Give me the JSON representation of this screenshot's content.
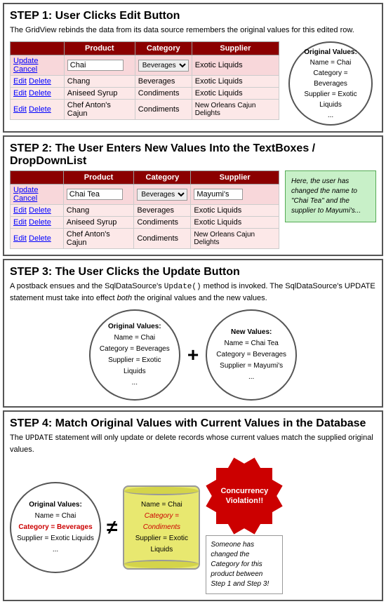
{
  "step1": {
    "title": "STEP 1: User Clicks Edit Button",
    "description": "The GridView rebinds the data from its data source remembers the original values for this edited row.",
    "original_values_circle": {
      "line1": "Original Values:",
      "line2": "Name = Chai",
      "line3": "Category = Beverages",
      "line4": "Supplier = Exotic Liquids",
      "line5": "..."
    },
    "table": {
      "headers": [
        "Product",
        "Category",
        "Supplier"
      ],
      "rows": [
        {
          "type": "edit",
          "actions": "Update Cancel",
          "product_input": "Chai",
          "category_select": "Beverages",
          "supplier": "Exotic Liquids"
        },
        {
          "type": "normal",
          "actions": "Edit Delete",
          "product": "Chang",
          "category": "Beverages",
          "supplier": "Exotic Liquids"
        },
        {
          "type": "normal",
          "actions": "Edit Delete",
          "product": "Aniseed Syrup",
          "category": "Condiments",
          "supplier": "Exotic Liquids"
        },
        {
          "type": "normal",
          "actions": "Edit Delete",
          "product": "Chef Anton's Cajun",
          "category": "Condiments",
          "supplier": "New Orleans Cajun Delights"
        }
      ]
    }
  },
  "step2": {
    "title": "STEP 2: The User Enters New Values Into the TextBoxes / DropDownList",
    "green_note": "Here, the user has changed the name to \"Chai Tea\" and the supplier to Mayumi's...",
    "table": {
      "headers": [
        "Product",
        "Category",
        "Supplier"
      ],
      "rows": [
        {
          "type": "edit",
          "actions": "Update Cancel",
          "product_input": "Chai Tea",
          "category_select": "Beverages",
          "supplier_input": "Mayumi's"
        },
        {
          "type": "normal",
          "actions": "Edit Delete",
          "product": "Chang",
          "category": "Beverages",
          "supplier": "Exotic Liquids"
        },
        {
          "type": "normal",
          "actions": "Edit Delete",
          "product": "Aniseed Syrup",
          "category": "Condiments",
          "supplier": "Exotic Liquids"
        },
        {
          "type": "normal",
          "actions": "Edit Delete",
          "product": "Chef Anton's Cajun",
          "category": "Condiments",
          "supplier": "New Orleans Cajun Delights"
        }
      ]
    }
  },
  "step3": {
    "title": "STEP 3: The User Clicks the Update Button",
    "description": "A postback ensues and the SqlDataSource's Update() method is invoked. The SqlDataSource's UPDATE statement must take into effect both the original values and the new values.",
    "original_circle": {
      "title": "Original Values:",
      "lines": [
        "Name = Chai",
        "Category = Beverages",
        "Supplier = Exotic Liquids",
        "..."
      ]
    },
    "new_circle": {
      "title": "New Values:",
      "lines": [
        "Name = Chai Tea",
        "Category = Beverages",
        "Supplier = Mayumi's",
        "..."
      ]
    }
  },
  "step4": {
    "title": "STEP 4: Match Original Values with Current Values in the Database",
    "description": "The UPDATE statement will only update or delete records whose current values match the supplied original values.",
    "original_circle": {
      "title": "Original Values:",
      "lines": [
        "Name = Chai",
        "Category = Beverages",
        "Supplier = Exotic Liquids",
        "..."
      ],
      "red_line": "Category = Beverages"
    },
    "cylinder": {
      "lines": [
        "Name = Chai",
        "Category = Condiments",
        "Supplier = Exotic Liquids"
      ],
      "red_line": "Category = Condiments"
    },
    "starburst": {
      "line1": "Concurrency",
      "line2": "Violation!!"
    },
    "italic_note": "Someone has changed the Category for this product between Step 1 and Step 3!"
  }
}
